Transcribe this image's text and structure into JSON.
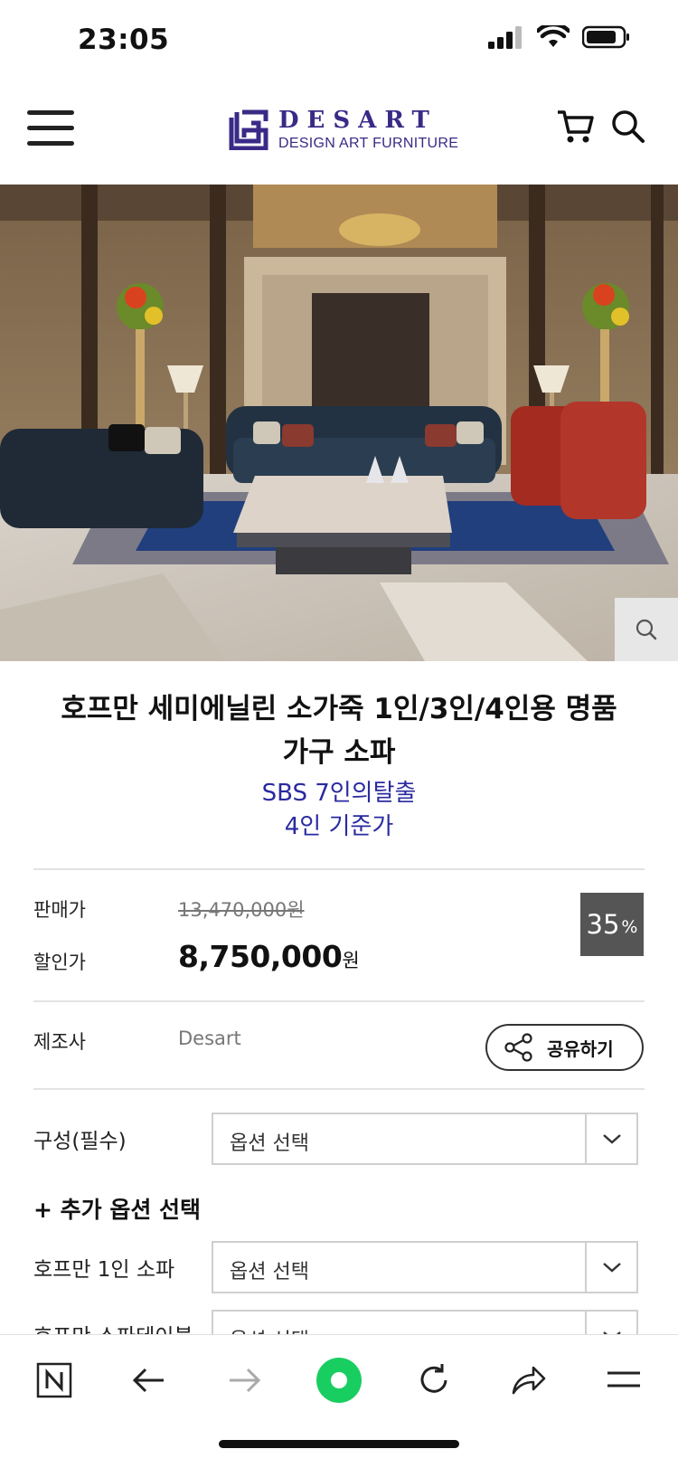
{
  "status_bar": {
    "time": "23:05"
  },
  "header": {
    "logo_title": "DESART",
    "logo_subtitle": "DESIGN ART FURNITURE",
    "brand_color": "#3a2a86"
  },
  "product": {
    "title_line1": "호프만 세미에닐린 소가죽 1인/3인/4인용 명품",
    "title_line2": "가구 소파",
    "subtitle1": "SBS 7인의탈출",
    "subtitle2": "4인 기준가"
  },
  "price": {
    "list_label": "판매가",
    "list_value": "13,470,000원",
    "sale_label": "할인가",
    "sale_value": "8,750,000",
    "sale_unit": "원",
    "discount_value": "35",
    "discount_unit": "%"
  },
  "maker": {
    "label": "제조사",
    "value": "Desart"
  },
  "share": {
    "label": "공유하기"
  },
  "options": {
    "required_label": "구성(필수)",
    "placeholder": "옵션 선택",
    "add_option_label": "+ 추가 옵션 선택",
    "extra1_label": "호프만 1인 소파",
    "extra2_label": "호프만 소파테이블"
  }
}
